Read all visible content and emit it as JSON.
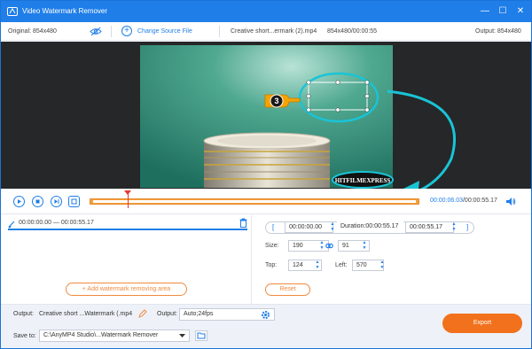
{
  "app": {
    "title": "Video Watermark Remover"
  },
  "window_controls": {
    "minimize": "—",
    "maximize": "☐",
    "close": "✕"
  },
  "infobar": {
    "original": "Original: 854x480",
    "change_source": "Change Source File",
    "file_name": "Creative short...ermark (2).mp4",
    "file_info": "854x480/00:00:55",
    "output": "Output: 854x480"
  },
  "preview": {
    "callout_number": "3",
    "watermark_text": "HITFILMEXPRESS"
  },
  "timeline": {
    "current": "00:00:06.03",
    "total": "/00:00:55.17"
  },
  "ranges": [
    {
      "label": "00:00:00.00 — 00:00:55.17"
    }
  ],
  "add_area_label": "+ Add watermark removing area",
  "controls": {
    "start_time": "00:00:00.00",
    "duration_label": "Duration:00:00:55.17",
    "end_time": "00:00:55.17",
    "size_label": "Size:",
    "width": "190",
    "height": "91",
    "top_label": "Top:",
    "top": "124",
    "left_label": "Left:",
    "left": "570",
    "reset": "Reset"
  },
  "bottom": {
    "output_label": "Output:",
    "output_file": "Creative short ...Watermark (.mp4",
    "output_setting_label": "Output:",
    "output_setting": "Auto;24fps",
    "save_label": "Save to:",
    "save_path": "C:\\AnyMP4 Studio\\...Watermark Remover",
    "export": "Export"
  },
  "colors": {
    "accent_blue": "#1f7ee8",
    "orange": "#f2711c",
    "preview_bg": "#262729",
    "teal_backdrop": "#2f8f7b",
    "callout_cyan": "#19c4d6",
    "highlight_yellow": "#f1e43a"
  }
}
